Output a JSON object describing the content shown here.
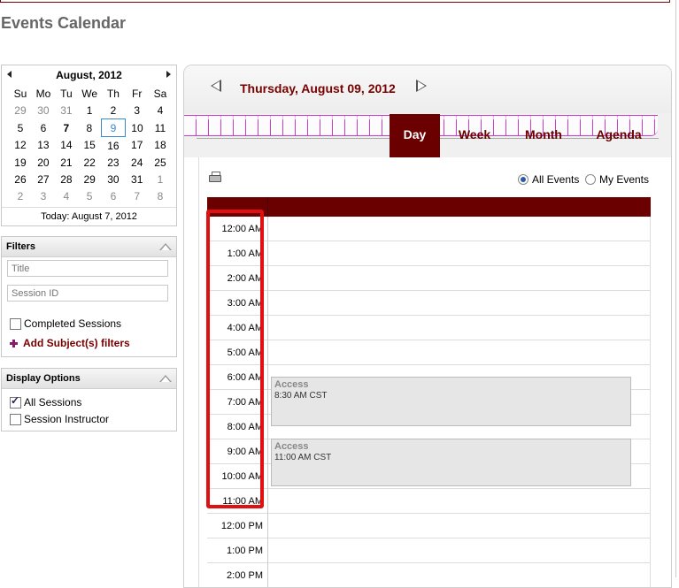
{
  "page": {
    "title": "Events Calendar"
  },
  "mini_calendar": {
    "month_label": "August, 2012",
    "weekdays": [
      "Su",
      "Mo",
      "Tu",
      "We",
      "Th",
      "Fr",
      "Sa"
    ],
    "weeks": [
      [
        {
          "d": "29",
          "o": true
        },
        {
          "d": "30",
          "o": true
        },
        {
          "d": "31",
          "o": true
        },
        {
          "d": "1"
        },
        {
          "d": "2"
        },
        {
          "d": "3"
        },
        {
          "d": "4"
        }
      ],
      [
        {
          "d": "5"
        },
        {
          "d": "6"
        },
        {
          "d": "7",
          "t": true
        },
        {
          "d": "8"
        },
        {
          "d": "9",
          "s": true
        },
        {
          "d": "10"
        },
        {
          "d": "11"
        }
      ],
      [
        {
          "d": "12"
        },
        {
          "d": "13"
        },
        {
          "d": "14"
        },
        {
          "d": "15"
        },
        {
          "d": "16"
        },
        {
          "d": "17"
        },
        {
          "d": "18"
        }
      ],
      [
        {
          "d": "19"
        },
        {
          "d": "20"
        },
        {
          "d": "21"
        },
        {
          "d": "22"
        },
        {
          "d": "23"
        },
        {
          "d": "24"
        },
        {
          "d": "25"
        }
      ],
      [
        {
          "d": "26"
        },
        {
          "d": "27"
        },
        {
          "d": "28"
        },
        {
          "d": "29"
        },
        {
          "d": "30"
        },
        {
          "d": "31"
        },
        {
          "d": "1",
          "o": true
        }
      ],
      [
        {
          "d": "2",
          "o": true
        },
        {
          "d": "3",
          "o": true
        },
        {
          "d": "4",
          "o": true
        },
        {
          "d": "5",
          "o": true
        },
        {
          "d": "6",
          "o": true
        },
        {
          "d": "7",
          "o": true
        },
        {
          "d": "8",
          "o": true
        }
      ]
    ],
    "today_label": "Today: August 7, 2012"
  },
  "filters": {
    "title": "Filters",
    "title_placeholder": "Title",
    "session_placeholder": "Session ID",
    "completed_label": "Completed Sessions",
    "add_subject_label": "Add Subject(s) filters"
  },
  "display_options": {
    "title": "Display Options",
    "all_sessions_label": "All Sessions",
    "instructor_label": "Session Instructor"
  },
  "scheduler": {
    "date_label": "Thursday, August 09, 2012",
    "tabs": [
      "Day",
      "Week",
      "Month",
      "Agenda"
    ],
    "active_tab": "Day",
    "all_events_label": "All Events",
    "my_events_label": "My Events",
    "times": [
      "12:00 AM",
      "1:00 AM",
      "2:00 AM",
      "3:00 AM",
      "4:00 AM",
      "5:00 AM",
      "6:00 AM",
      "7:00 AM",
      "8:00 AM",
      "9:00 AM",
      "10:00 AM",
      "11:00 AM",
      "12:00 PM",
      "1:00 PM",
      "2:00 PM"
    ],
    "events": [
      {
        "title": "Access",
        "time": "8:30 AM CST"
      },
      {
        "title": "Access",
        "time": "11:00 AM CST"
      }
    ]
  },
  "colors": {
    "brand": "#6b0000",
    "highlight": "#e01010",
    "accent": "#c21fc2"
  }
}
